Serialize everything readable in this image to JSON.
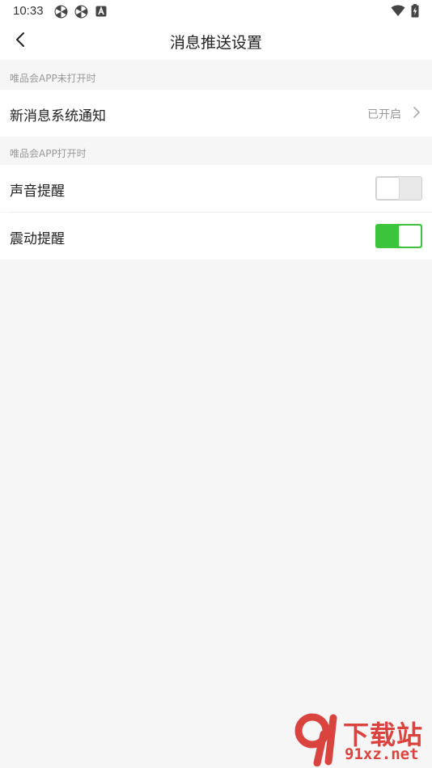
{
  "status_bar": {
    "time": "10:33",
    "icons": [
      "pinwheel-icon",
      "pinwheel-icon",
      "a-badge-icon",
      "wifi-icon",
      "battery-charging-icon"
    ]
  },
  "nav": {
    "back_icon": "chevron-left-icon",
    "title": "消息推送设置"
  },
  "sections": [
    {
      "header": "唯品会APP未打开时",
      "rows": [
        {
          "label": "新消息系统通知",
          "value": "已开启",
          "icon": "chevron-right-icon"
        }
      ]
    },
    {
      "header": "唯品会APP打开时",
      "rows": [
        {
          "label": "声音提醒",
          "toggle_on": false
        },
        {
          "label": "震动提醒",
          "toggle_on": true
        }
      ]
    }
  ],
  "colors": {
    "toggle_on": "#3cc43c",
    "toggle_off": "#e9e9e9",
    "background": "#f6f6f6",
    "watermark": "#d9443f"
  },
  "watermark": {
    "main": "下载站",
    "sub": "91xz.net"
  }
}
